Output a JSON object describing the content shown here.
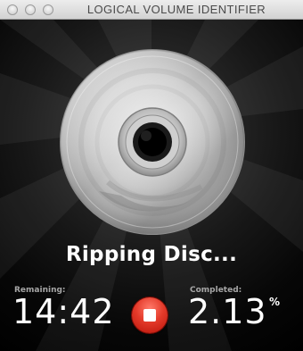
{
  "window": {
    "title": "LOGICAL VOLUME IDENTIFIER",
    "controls": [
      "close-button",
      "minimize-button",
      "zoom-button"
    ]
  },
  "status": {
    "text": "Ripping Disc..."
  },
  "progress": {
    "remaining_label": "Remaining:",
    "remaining_time": "14:42",
    "completed_label": "Completed:",
    "completed_value": "2.13",
    "percent_sign": "%"
  },
  "icons": {
    "disc": "disc-icon",
    "stop": "stop-icon"
  },
  "colors": {
    "stop_button": "#e43a2a",
    "background": "#000000",
    "text": "#ffffff",
    "label": "#a6a6a6"
  }
}
